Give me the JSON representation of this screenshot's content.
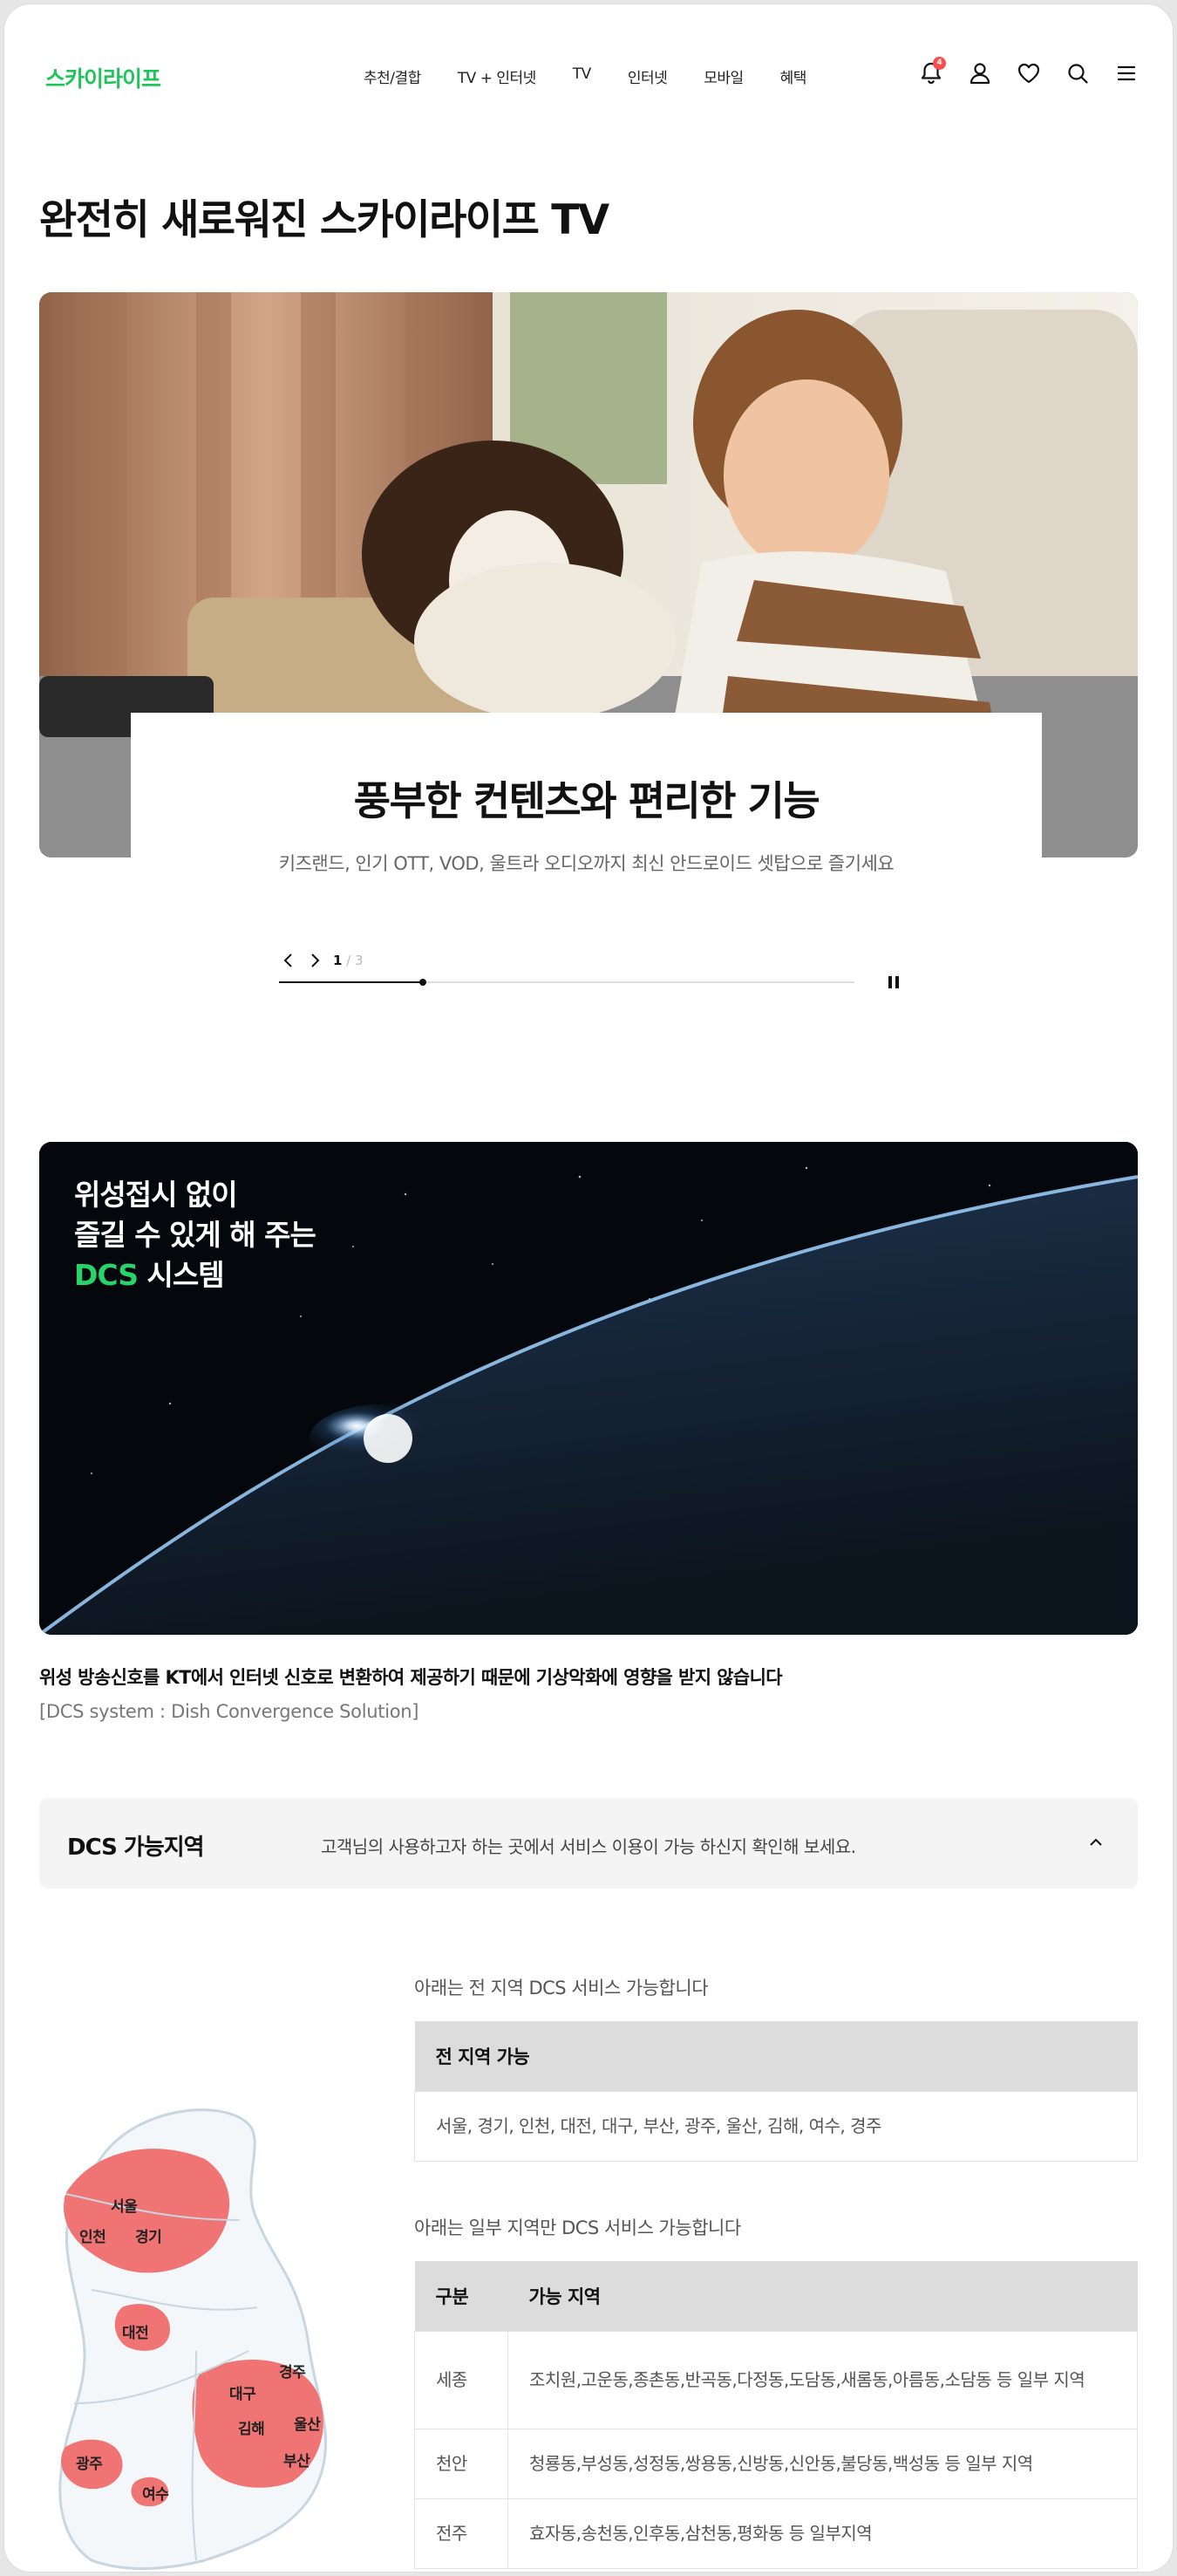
{
  "header": {
    "logo": "스카이라이프",
    "nav": [
      "추천/결합",
      "TV + 인터넷",
      "TV",
      "인터넷",
      "모바일",
      "혜택"
    ],
    "notification_count": "4",
    "icons": [
      "bell-icon",
      "user-icon",
      "heart-icon",
      "search-icon",
      "menu-icon"
    ]
  },
  "page": {
    "title": "완전히 새로워진 스카이라이프 TV"
  },
  "hero": {
    "title": "풍부한 컨텐츠와 편리한 기능",
    "description": "키즈랜드, 인기 OTT, VOD, 울트라 오디오까지 최신 안드로이드 셋탑으로 즐기세요",
    "current_page": "1",
    "total_pages": "3",
    "progress": 0.25
  },
  "dcs_banner": {
    "line1": "위성접시 없이",
    "line2": "즐길 수 있게 해 주는",
    "highlight": "DCS",
    "line3_rest": " 시스템",
    "description": "위성 방송신호를 KT에서 인터넷 신호로 변환하여 제공하기 때문에 기상악화에 영향을 받지 않습니다",
    "sub": "[DCS system : Dish Convergence Solution]"
  },
  "accordion": {
    "title": "DCS 가능지역",
    "text": "고객님의 사용하고자 하는 곳에서 서비스 이용이 가능 하신지 확인해 보세요.",
    "expanded": true
  },
  "map_labels": [
    "서울",
    "인천",
    "경기",
    "대전",
    "경주",
    "대구",
    "울산",
    "김해",
    "부산",
    "광주",
    "여수"
  ],
  "all_regions": {
    "caption": "아래는 전 지역 DCS 서비스 가능합니다",
    "header": "전 지역 가능",
    "value": "서울, 경기, 인천, 대전, 대구, 부산, 광주, 울산, 김해, 여수, 경주"
  },
  "partial_regions": {
    "caption": "아래는 일부 지역만 DCS 서비스 가능합니다",
    "headers": [
      "구분",
      "가능 지역"
    ],
    "rows": [
      {
        "region": "세종",
        "areas": "조치원,고운동,종촌동,반곡동,다정동,도담동,새롬동,아름동,소담동 등 일부 지역"
      },
      {
        "region": "천안",
        "areas": "청룡동,부성동,성정동,쌍용동,신방동,신안동,불당동,백성동 등 일부 지역"
      },
      {
        "region": "전주",
        "areas": "효자동,송천동,인후동,삼천동,평화동 등 일부지역"
      }
    ]
  },
  "colors": {
    "brand_green": "#1fc55a",
    "map_highlight": "#f07474",
    "badge_red": "#ff4b4b"
  }
}
